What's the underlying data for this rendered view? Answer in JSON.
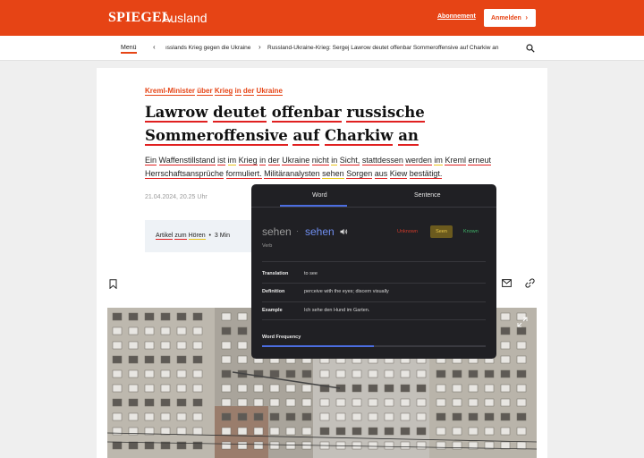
{
  "header": {
    "logo": "SPIEGEL",
    "section": "Ausland",
    "subscription_label": "Abonnement",
    "login_label": "Anmelden",
    "brand_color": "#e64415"
  },
  "nav": {
    "menu_label": "Menü",
    "breadcrumb_1": "ısslands Krieg gegen die Ukraine",
    "breadcrumb_2": "Russland-Ukraine-Krieg: Sergej Lawrow deutet offenbar Sommeroffensive auf Charkiw an"
  },
  "article": {
    "kicker": {
      "w1": "Kreml-Minister",
      "w2": "über",
      "w3": "Krieg",
      "w4": "in",
      "w5": "der",
      "w6": "Ukraine"
    },
    "headline": {
      "w1": "Lawrow",
      "w2": "deutet",
      "w3": "offenbar",
      "w4": "russische",
      "w5": "Sommeroffensive",
      "w6": "auf",
      "w7": "Charkiw",
      "w8": "an"
    },
    "lead": {
      "w1": "Ein",
      "w2": "Waffenstillstand",
      "w3": "ist",
      "w4": "im",
      "w5": "Krieg",
      "w6": "in",
      "w7": "der",
      "w8": "Ukraine",
      "w9": "nicht",
      "w10": "in",
      "w11": "Sicht,",
      "w12": "stattdessen",
      "w13": "werden",
      "w14": "im",
      "w15": "Kreml",
      "w16": "erneut",
      "w17": "Herrschaftsansprüche",
      "w18": "formuliert.",
      "w19": "Militäranalysten",
      "w20": "sehen",
      "w21": "Sorgen",
      "w22": "aus",
      "w23": "Kiew",
      "w24": "bestätigt."
    },
    "date": "21.04.2024, 20.25 Uhr",
    "listen": {
      "w1": "Artikel",
      "w2": "zum",
      "w3": "Hören",
      "duration": "3 Min"
    }
  },
  "popup": {
    "tabs": {
      "word": "Word",
      "sentence": "Sentence"
    },
    "active_tab": "Word",
    "word": "sehen",
    "lemma": "sehen",
    "separator": "·",
    "pos": "Verb",
    "levels": {
      "unknown": "Unknown",
      "seen": "Seen",
      "known": "Known"
    },
    "selected_level": "Seen",
    "rows": {
      "translation_label": "Translation",
      "translation": "to see",
      "definition_label": "Definition",
      "definition": "perceive with the eyes; discern visually",
      "example_label": "Example",
      "example": "Ich sehe den Hund im Garten."
    },
    "frequency_label": "Word Frequency",
    "frequency": 0.5,
    "accent": "#4b6de0"
  }
}
